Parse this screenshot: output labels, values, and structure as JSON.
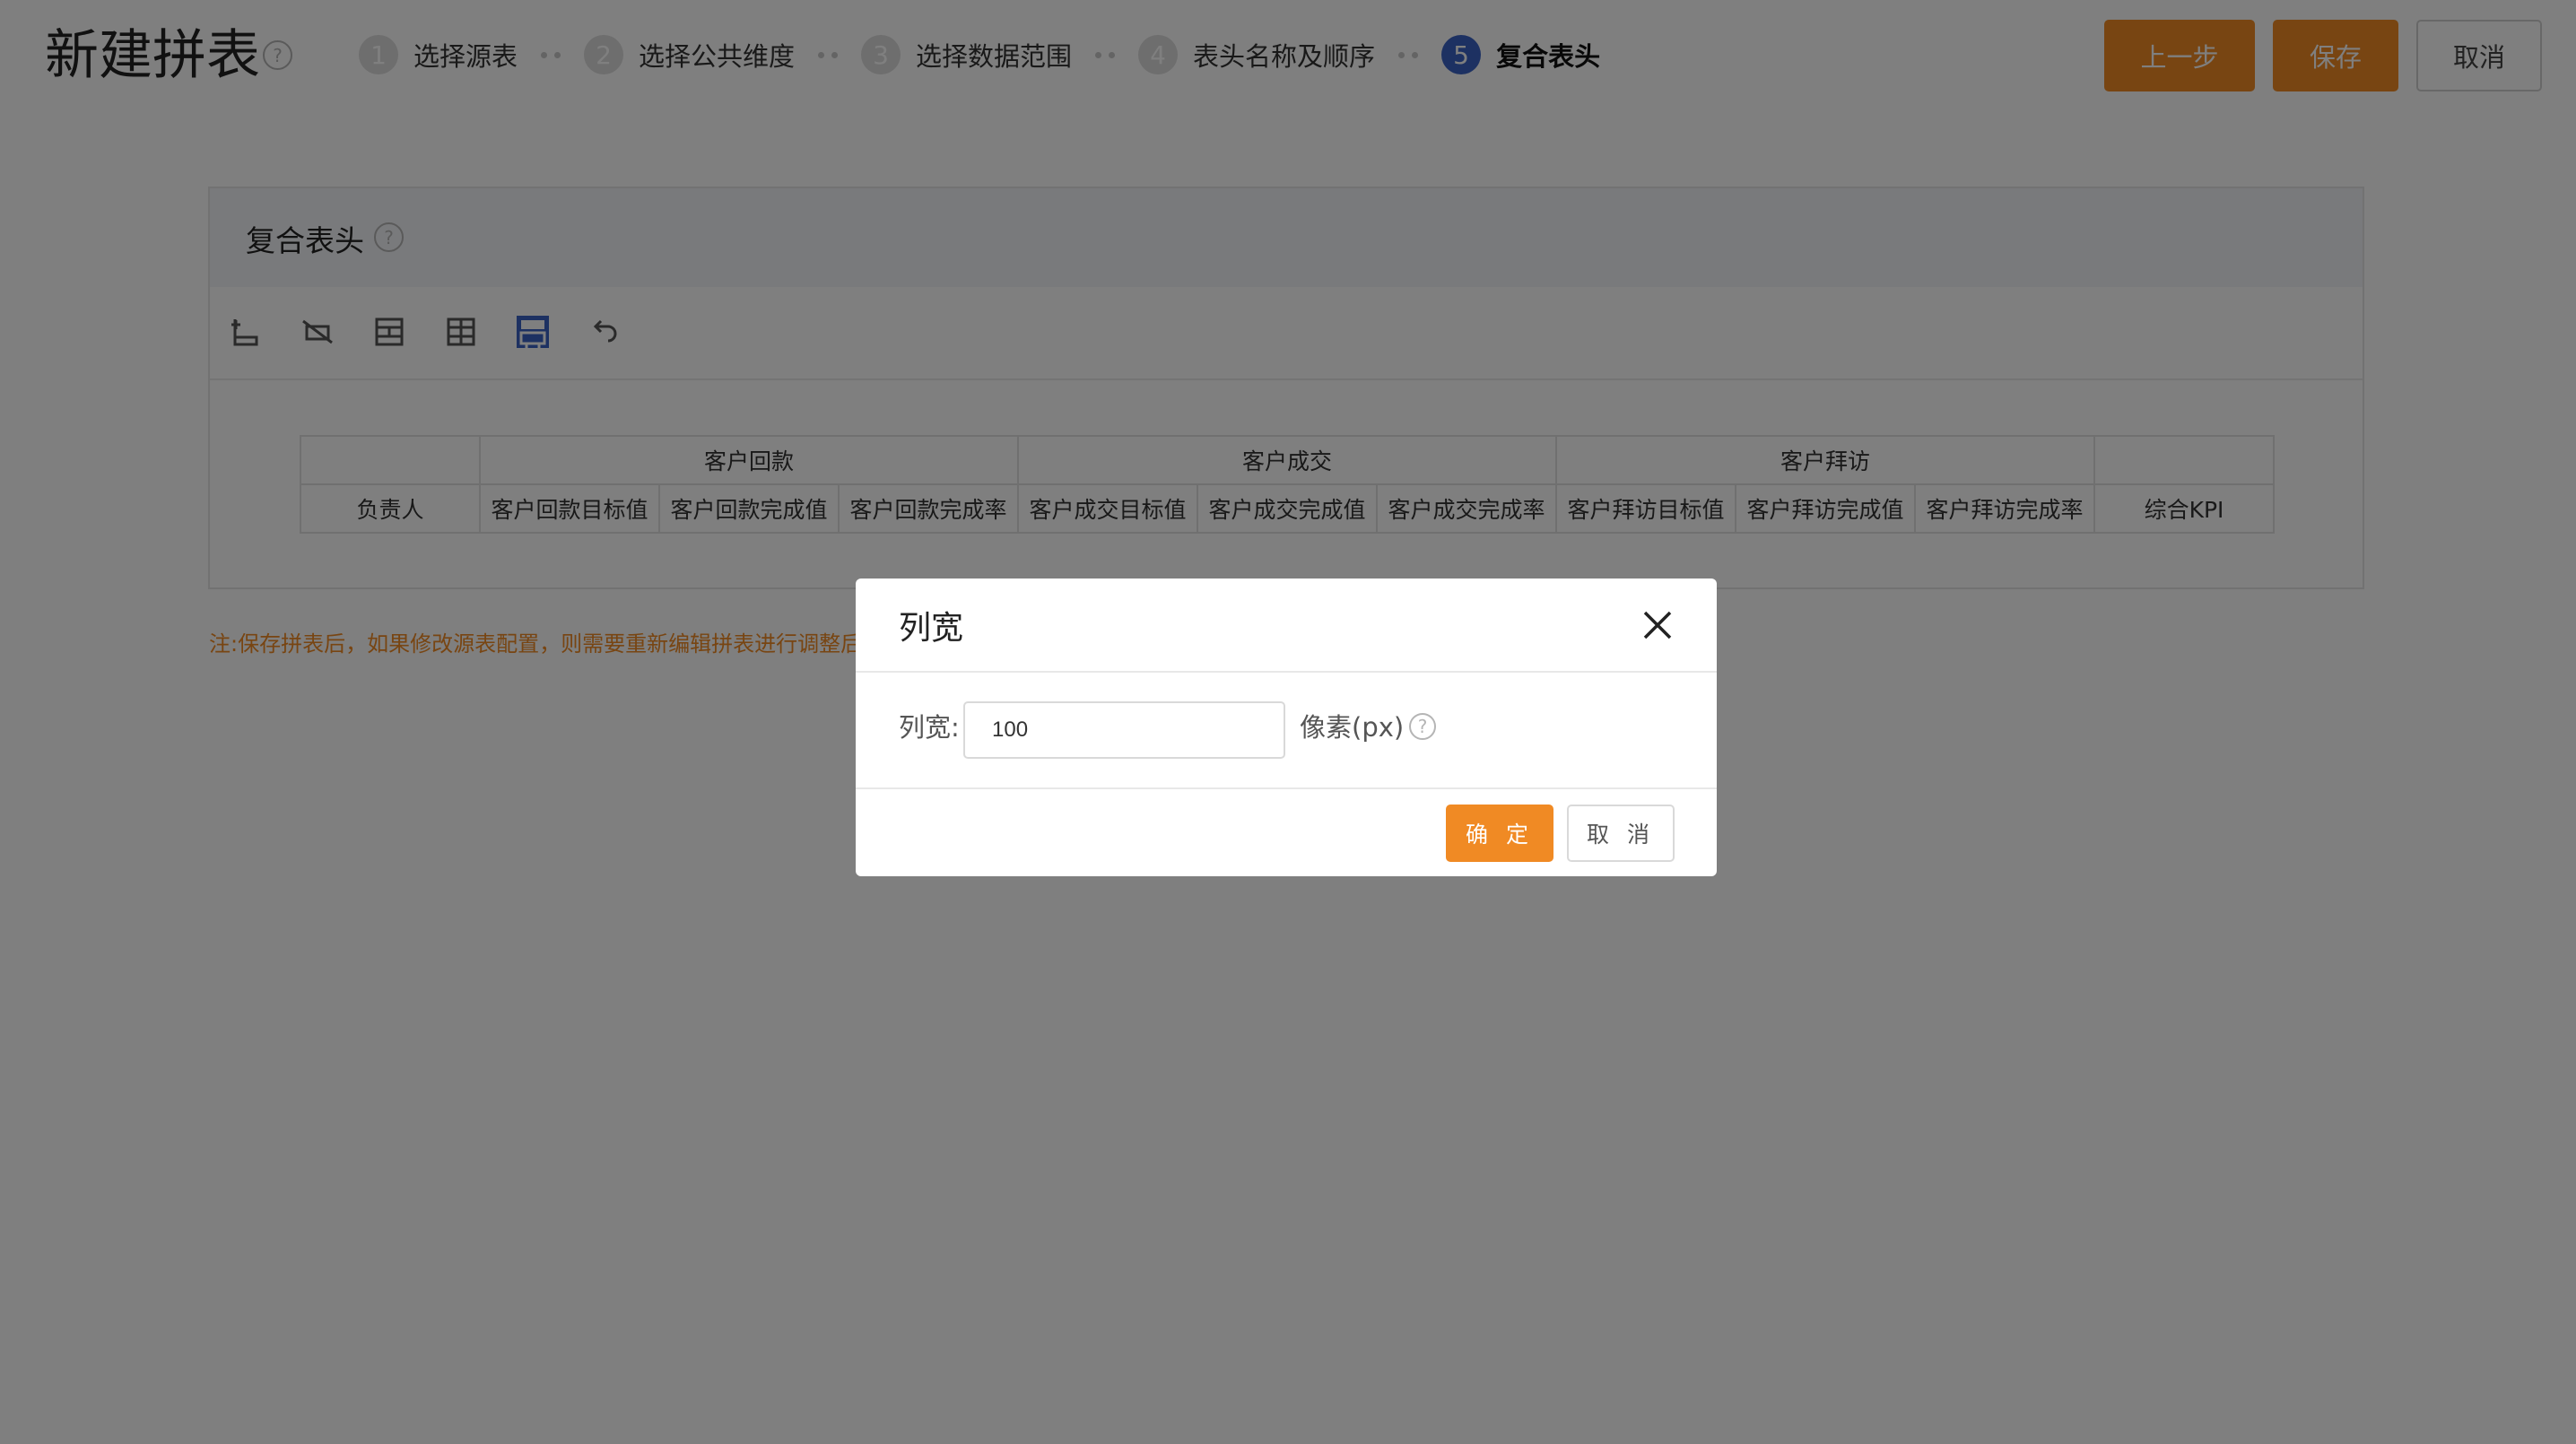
{
  "header": {
    "title": "新建拼表",
    "steps": [
      {
        "num": "1",
        "label": "选择源表"
      },
      {
        "num": "2",
        "label": "选择公共维度"
      },
      {
        "num": "3",
        "label": "选择数据范围"
      },
      {
        "num": "4",
        "label": "表头名称及顺序"
      },
      {
        "num": "5",
        "label": "复合表头"
      }
    ],
    "active_step": 5,
    "buttons": {
      "prev": "上一步",
      "save": "保存",
      "cancel": "取消"
    }
  },
  "panel": {
    "title": "复合表头",
    "toolbar": [
      "insert-row-icon",
      "delete-row-icon",
      "merge-cells-icon",
      "split-cells-icon",
      "column-width-icon",
      "undo-icon"
    ],
    "active_tool": "column-width-icon",
    "group_headers": [
      "",
      "客户回款",
      "客户成交",
      "客户拜访",
      ""
    ],
    "column_headers": [
      "负责人",
      "客户回款目标值",
      "客户回款完成值",
      "客户回款完成率",
      "客户成交目标值",
      "客户成交完成值",
      "客户成交完成率",
      "客户拜访目标值",
      "客户拜访完成值",
      "客户拜访完成率",
      "综合KPI"
    ]
  },
  "note": "注:保存拼表后，如果修改源表配置，则需要重新编辑拼表进行调整后",
  "dialog": {
    "title": "列宽",
    "field_label": "列宽:",
    "field_value": "100",
    "unit": "像素(px)",
    "ok": "确 定",
    "cancel": "取 消"
  },
  "colors": {
    "accent": "#f08a24",
    "active_step": "#3b63c4"
  }
}
